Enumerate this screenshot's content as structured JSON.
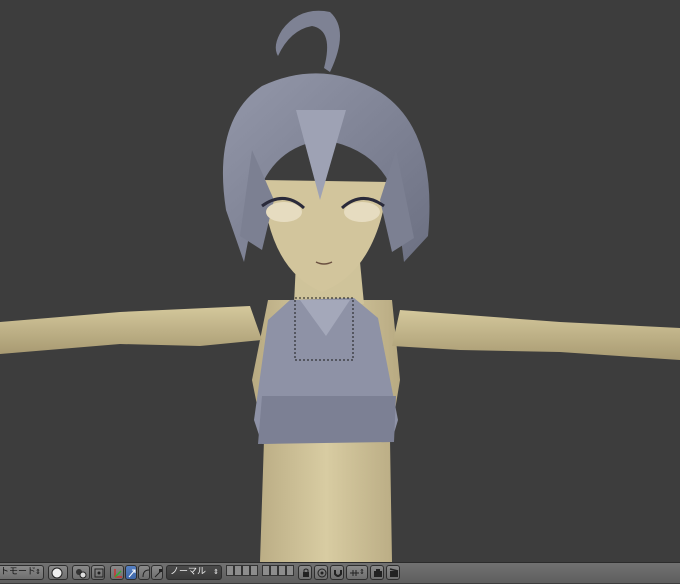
{
  "viewport": {
    "background": "#3d3d3d",
    "selection_box": "dotted-rectangle"
  },
  "header": {
    "mode_label": "トモード",
    "pivot_icon": "viewport-shading-icon",
    "orientation_label": "ノーマル",
    "colors": {
      "accent": "#4f78bb",
      "bar": "#6a6a6a"
    }
  }
}
